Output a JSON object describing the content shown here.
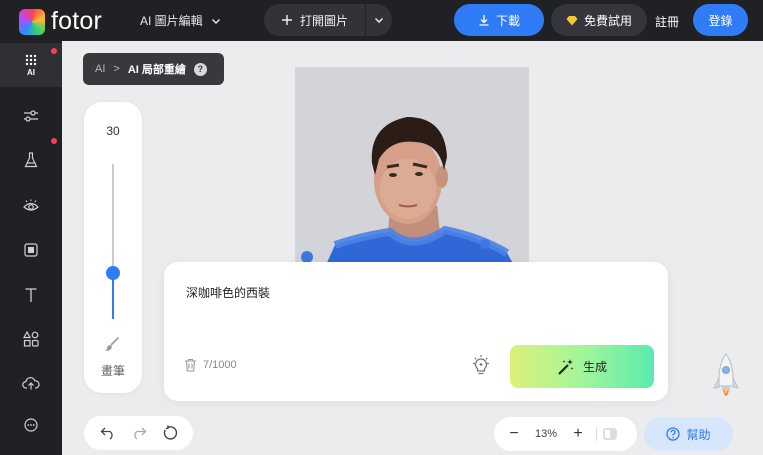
{
  "topbar": {
    "logo_text": "fotor",
    "menu_ai": "AI 圖片編輯",
    "open_image": "打開圖片",
    "download": "下載",
    "free_trial": "免費試用",
    "register": "註冊",
    "login": "登錄"
  },
  "sidebar": {
    "items": [
      {
        "label": "AI",
        "icon": "apps-grid-icon"
      },
      {
        "icon": "sliders-icon"
      },
      {
        "icon": "flask-icon"
      },
      {
        "icon": "eye-icon"
      },
      {
        "icon": "frame-icon"
      },
      {
        "icon": "text-icon"
      },
      {
        "icon": "shapes-icon"
      },
      {
        "icon": "cloud-upload-icon"
      },
      {
        "icon": "more-icon"
      }
    ]
  },
  "breadcrumb": {
    "root": "AI",
    "separator": ">",
    "current": "AI 局部重繪",
    "help": "?"
  },
  "brush": {
    "size": "30",
    "label": "畫筆",
    "level_fraction": 0.7
  },
  "prompt": {
    "text": "深咖啡色的西裝",
    "counter": "7/1000",
    "generate": "生成"
  },
  "zoom": {
    "minus": "−",
    "value": "13%",
    "plus": "+"
  },
  "help_button": "幫助",
  "colors": {
    "accent": "#2f7cf6",
    "topbar": "#202124",
    "mask": "#3a6fd8"
  }
}
